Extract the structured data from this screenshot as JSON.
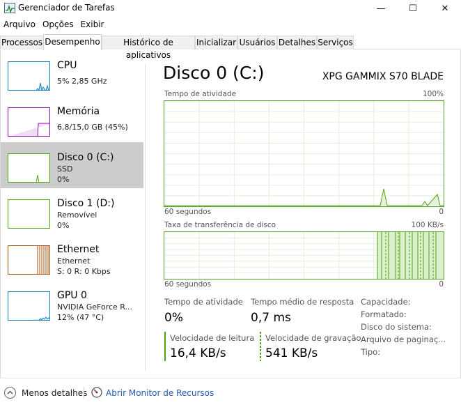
{
  "window": {
    "title": "Gerenciador de Tarefas",
    "minimize": "—",
    "maximize": "☐",
    "close": "✕"
  },
  "menu": [
    "Arquivo",
    "Opções",
    "Exibir"
  ],
  "tabs": [
    "Processos",
    "Desempenho",
    "Histórico de aplicativos",
    "Inicializar",
    "Usuários",
    "Detalhes",
    "Serviços"
  ],
  "active_tab": "Desempenho",
  "sidebar": [
    {
      "title": "CPU",
      "lines": [
        "5%  2,85 GHz"
      ],
      "color": "#117dbb"
    },
    {
      "title": "Memória",
      "lines": [
        "6,8/15,0 GB (45%)"
      ],
      "color": "#8b12ae"
    },
    {
      "title": "Disco 0 (C:)",
      "lines": [
        "SSD",
        "0%"
      ],
      "color": "#4da60c"
    },
    {
      "title": "Disco 1 (D:)",
      "lines": [
        "Removível",
        "0%"
      ],
      "color": "#4da60c"
    },
    {
      "title": "Ethernet",
      "lines": [
        "Ethernet",
        "S: 0  R: 0 Kbps"
      ],
      "color": "#a74f01"
    },
    {
      "title": "GPU 0",
      "lines": [
        "NVIDIA GeForce R...",
        "12%  (47 °C)"
      ],
      "color": "#117dbb"
    }
  ],
  "main": {
    "title": "Disco 0 (C:)",
    "device": "XPG GAMMIX S70 BLADE",
    "graph1": {
      "label": "Tempo de atividade",
      "max": "100%",
      "time": "60 segundos",
      "min": "0"
    },
    "graph2": {
      "label": "Taxa de transferência de disco",
      "max": "100 KB/s",
      "time": "60 segundos",
      "min": "0"
    },
    "stats": {
      "active_time_label": "Tempo de atividade",
      "active_time_value": "0%",
      "response_label": "Tempo médio de resposta",
      "response_value": "0,7 ms",
      "read_label": "Velocidade de leitura",
      "read_value": "16,4 KB/s",
      "write_label": "Velocidade de gravação",
      "write_value": "541 KB/s"
    },
    "properties": [
      "Capacidade:",
      "Formatado:",
      "Disco do sistema:",
      "Arquivo de paginaç...",
      "Tipo:"
    ]
  },
  "footer": {
    "less_details": "Menos detalhes",
    "resource_monitor": "Abrir Monitor de Recursos"
  }
}
